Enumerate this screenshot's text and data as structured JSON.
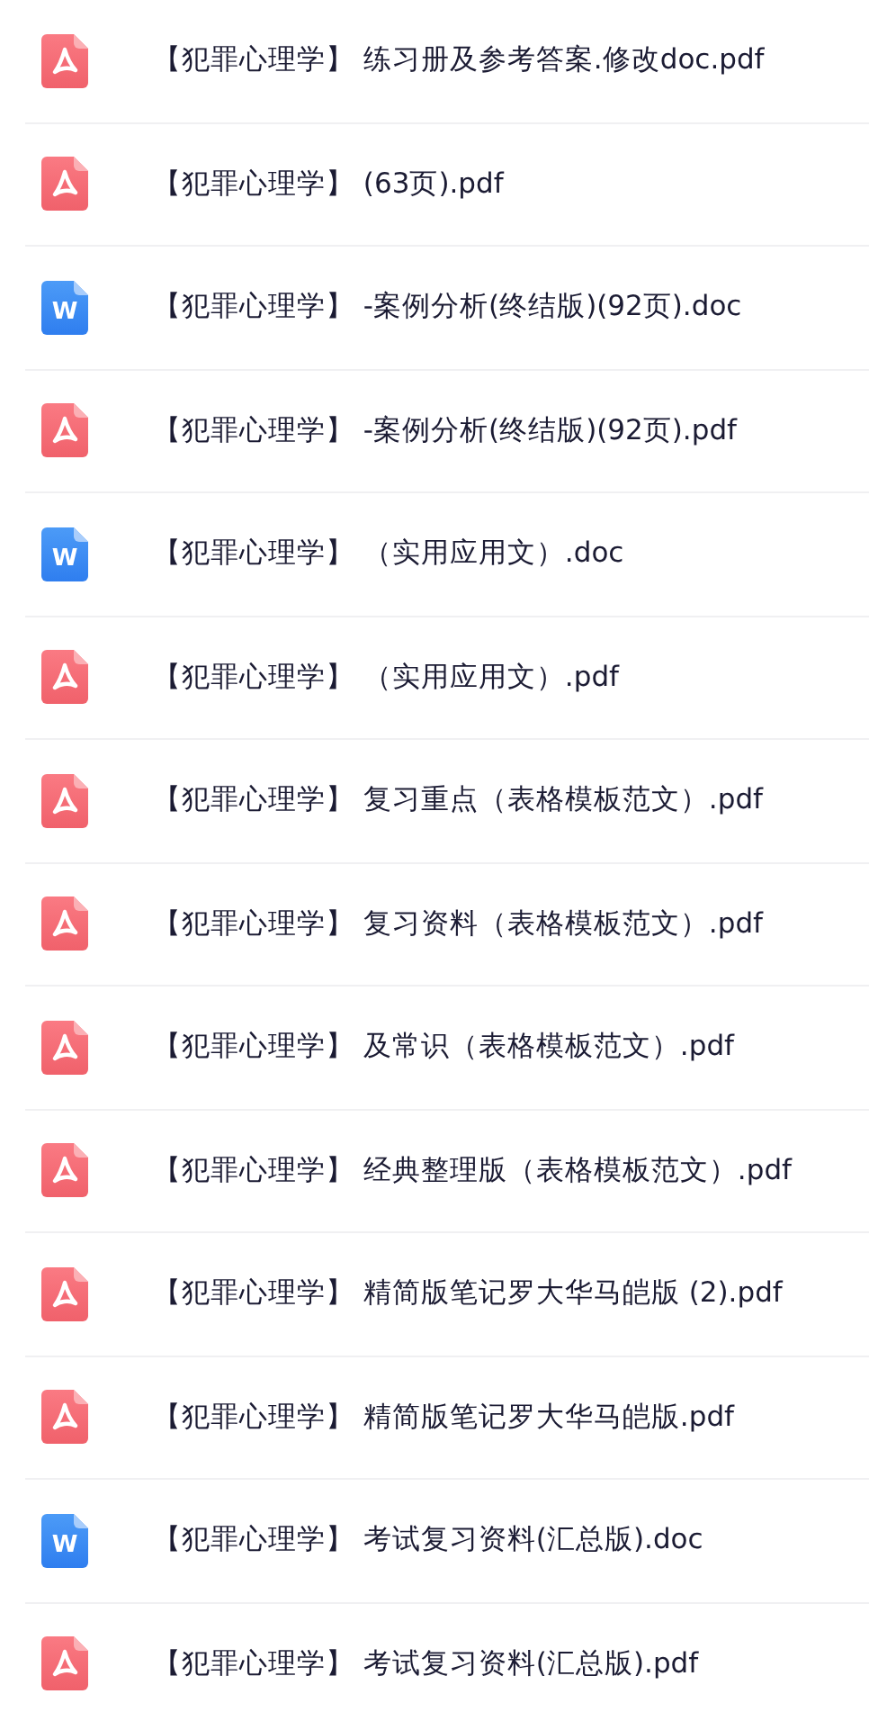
{
  "files": [
    {
      "kind": "pdf",
      "name": "【犯罪心理学】  练习册及参考答案.修改doc.pdf"
    },
    {
      "kind": "pdf",
      "name": "【犯罪心理学】 (63页).pdf"
    },
    {
      "kind": "doc",
      "icon_text": "W",
      "name": "【犯罪心理学】 -案例分析(终结版)(92页).doc"
    },
    {
      "kind": "pdf",
      "name": "【犯罪心理学】 -案例分析(终结版)(92页).pdf"
    },
    {
      "kind": "doc",
      "icon_text": "W",
      "name": "【犯罪心理学】 （实用应用文）.doc"
    },
    {
      "kind": "pdf",
      "name": "【犯罪心理学】 （实用应用文）.pdf"
    },
    {
      "kind": "pdf",
      "name": "【犯罪心理学】 复习重点（表格模板范文）.pdf"
    },
    {
      "kind": "pdf",
      "name": "【犯罪心理学】 复习资料（表格模板范文）.pdf"
    },
    {
      "kind": "pdf",
      "name": "【犯罪心理学】 及常识（表格模板范文）.pdf"
    },
    {
      "kind": "pdf",
      "name": "【犯罪心理学】 经典整理版（表格模板范文）.pdf"
    },
    {
      "kind": "pdf",
      "name": "【犯罪心理学】 精简版笔记罗大华马皑版 (2).pdf"
    },
    {
      "kind": "pdf",
      "name": "【犯罪心理学】 精简版笔记罗大华马皑版.pdf"
    },
    {
      "kind": "doc",
      "icon_text": "W",
      "name": "【犯罪心理学】 考试复习资料(汇总版).doc"
    },
    {
      "kind": "pdf",
      "name": "【犯罪心理学】 考试复习资料(汇总版).pdf"
    }
  ]
}
